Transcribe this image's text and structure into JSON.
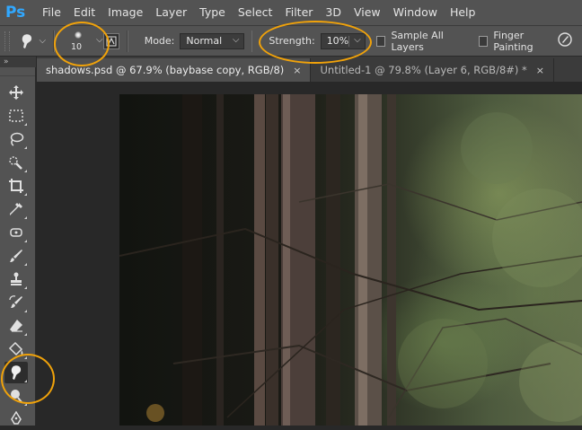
{
  "app": {
    "logo": "Ps"
  },
  "menu": [
    "File",
    "Edit",
    "Image",
    "Layer",
    "Type",
    "Select",
    "Filter",
    "3D",
    "View",
    "Window",
    "Help"
  ],
  "options": {
    "tool_icon": "smudge-icon",
    "brush_size": "10",
    "mode_label": "Mode:",
    "mode_value": "Normal",
    "strength_label": "Strength:",
    "strength_value": "10%",
    "sample_all_layers": {
      "label": "Sample All Layers",
      "checked": false
    },
    "finger_painting": {
      "label": "Finger Painting",
      "checked": false
    },
    "pressure_icon": "pen-pressure-icon"
  },
  "tabs": [
    {
      "label": "shadows.psd @ 67.9% (baybase copy, RGB/8)",
      "close": "×",
      "active": true
    },
    {
      "label": "Untitled-1 @ 79.8% (Layer 6, RGB/8#) *",
      "close": "×",
      "active": false
    }
  ],
  "toolbar": {
    "collapse_glyph": "»",
    "tools": [
      "move-tool",
      "marquee-tool",
      "lasso-tool",
      "quick-selection-tool",
      "crop-tool",
      "eyedropper-tool",
      "spot-healing-tool",
      "brush-tool",
      "clone-stamp-tool",
      "history-brush-tool",
      "eraser-tool",
      "paint-bucket-tool",
      "smudge-tool",
      "dodge-tool",
      "pen-tool"
    ],
    "active_tool": "smudge-tool"
  },
  "colors": {
    "annotation": "#f0a20a",
    "ui_panel": "#535353",
    "ps_blue": "#31a8ff"
  }
}
